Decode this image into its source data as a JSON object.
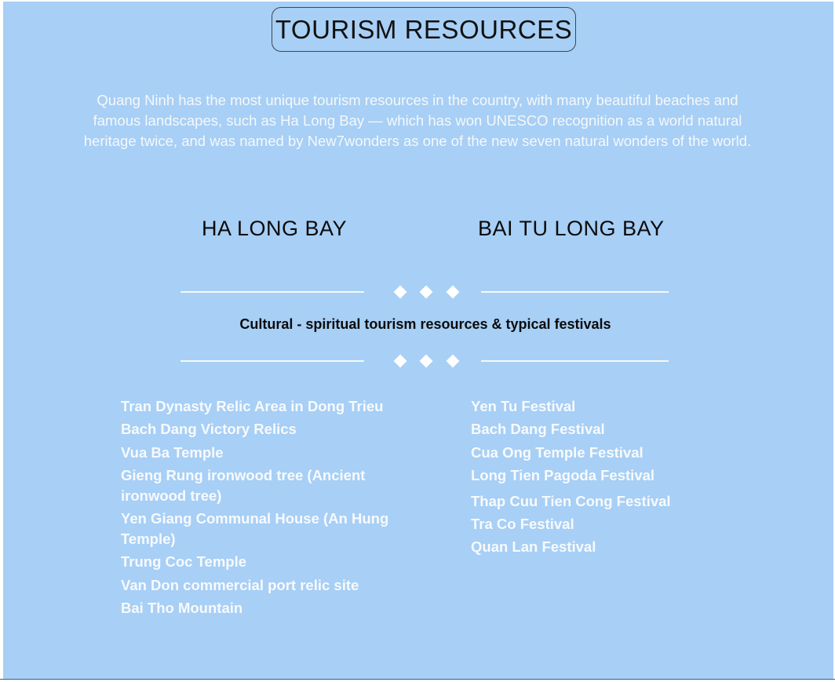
{
  "title": "TOURISM RESOURCES",
  "intro": "Quang Ninh has the most unique tourism resources in the country, with many beautiful beaches and famous landscapes, such as Ha Long Bay — which has won UNESCO recognition as a world natural heritage twice, and was named by New7wonders as one of the new seven natural wonders of the world.",
  "bays": [
    "HA LONG BAY",
    "BAI TU LONG BAY"
  ],
  "section_title": "Cultural - spiritual tourism resources & typical festivals",
  "relics": [
    "Tran Dynasty Relic Area in Dong Trieu",
    "Bach Dang Victory Relics",
    "Vua Ba Temple",
    "Gieng Rung ironwood tree (Ancient ironwood tree)",
    "Yen Giang Communal House (An Hung Temple)",
    "Trung Coc Temple",
    "Van Don commercial port relic site",
    "Bai Tho Mountain"
  ],
  "festivals": [
    "Yen Tu Festival",
    "Bach Dang Festival",
    "Cua Ong Temple Festival",
    "Long Tien Pagoda Festival",
    "Thap Cuu Tien Cong Festival",
    "Tra Co Festival",
    "Quan Lan Festival"
  ],
  "colors": {
    "background": "#a8cff5",
    "text_light": "#f4f8fc",
    "text_dark": "#0b0b0b"
  }
}
